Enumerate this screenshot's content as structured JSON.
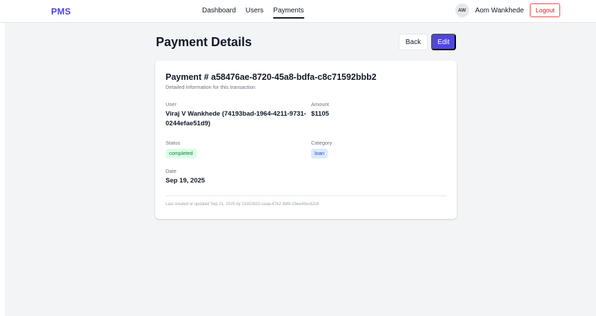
{
  "nav": {
    "brand": "PMS",
    "links": [
      "Dashboard",
      "Users",
      "Payments"
    ],
    "active": "Payments",
    "avatar_initials": "AW",
    "user_name": "Aom Wankhede",
    "logout_label": "Logout"
  },
  "page": {
    "title": "Payment Details",
    "back_label": "Back",
    "edit_label": "Edit"
  },
  "payment": {
    "title": "Payment # a58476ae-8720-45a8-bdfa-c8c71592bbb2",
    "subtitle": "Detailed information for this transaction",
    "user_label": "User",
    "user_value": "Viraj V Wankhede (74193bad-1964-4211-9731-0244efae51d9)",
    "amount_label": "Amount",
    "amount_value": "$1105",
    "status_label": "Status",
    "status_value": "completed",
    "category_label": "Category",
    "category_value": "loan",
    "date_label": "Date",
    "date_value": "Sep 19, 2025",
    "footer": "Last created or updated Sep 21, 2025 by 21b52b52-ceaa-47b2-9df4-29ee40ec62c6"
  },
  "colors": {
    "accent": "#4f46e5",
    "danger": "#ef4444",
    "status_bg": "#dcfce7",
    "category_bg": "#dbeafe"
  }
}
